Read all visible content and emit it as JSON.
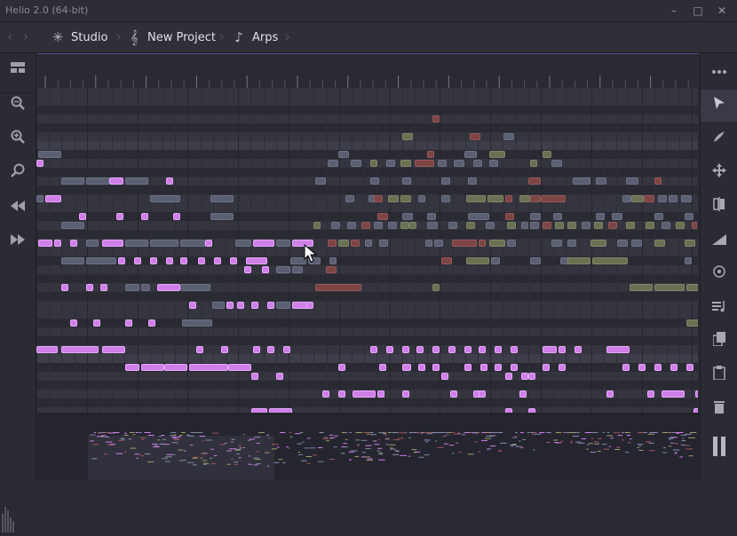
{
  "window": {
    "title": "Helio 2.0 (64-bit)",
    "minimize": "–",
    "maximize": "□",
    "close": "✕"
  },
  "nav": {
    "back_icon": "‹",
    "forward_icon": "›",
    "crumbs": [
      {
        "label": "Studio",
        "icon": "✳"
      },
      {
        "label": "New Project",
        "icon": "𝄞"
      },
      {
        "label": "Arps",
        "icon": "♪"
      }
    ]
  },
  "left_tools": [
    "view-layout-icon",
    "zoom-out-icon",
    "zoom-in-icon",
    "zoom-fit-icon",
    "rewind-icon",
    "fast-forward-icon"
  ],
  "right_tools": [
    "menu-icon",
    "cursor-tool-icon",
    "pen-tool-icon",
    "drag-tool-icon",
    "mirror-icon",
    "volume-ramp-icon",
    "target-icon",
    "arpeggiate-icon",
    "copy-icon",
    "paste-icon",
    "delete-icon",
    "pause-icon"
  ],
  "colors": {
    "accent": "#cf7fe8",
    "pattern_bar": "#5a4a8a"
  }
}
